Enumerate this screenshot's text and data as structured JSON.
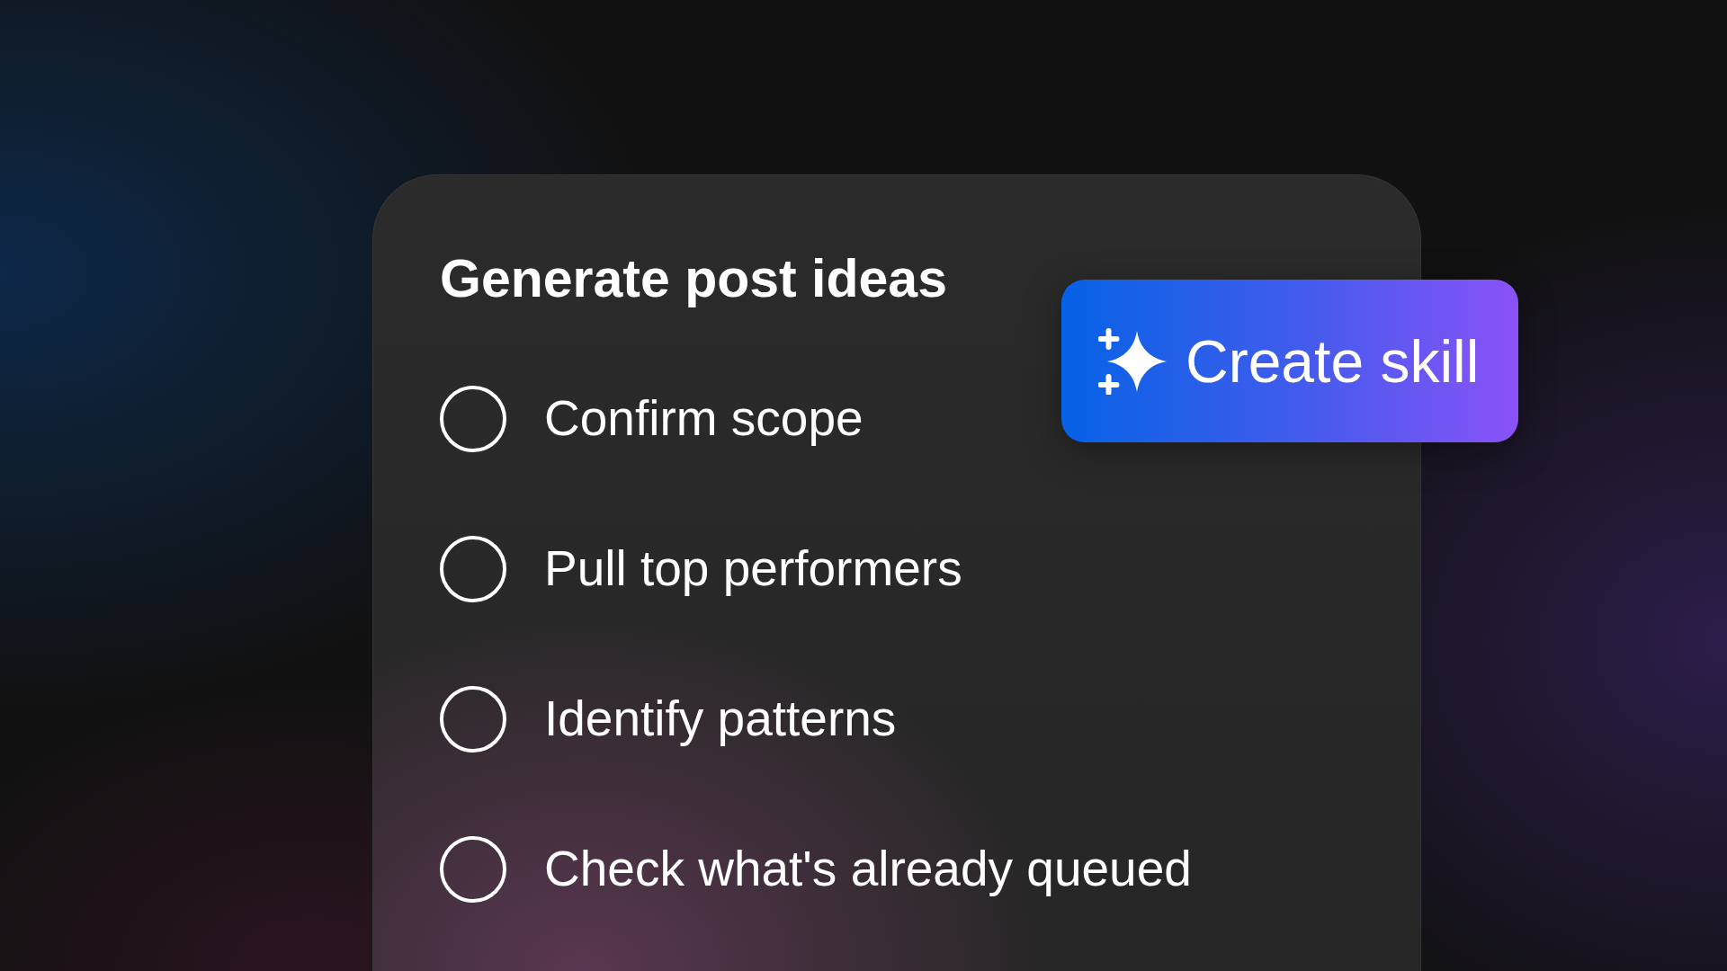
{
  "checklist": {
    "title": "Generate post ideas",
    "items": [
      {
        "label": "Confirm scope",
        "checked": false
      },
      {
        "label": "Pull top performers",
        "checked": false
      },
      {
        "label": "Identify patterns",
        "checked": false
      },
      {
        "label": "Check what's already queued",
        "checked": false
      }
    ]
  },
  "action_button": {
    "label": "Create skill"
  }
}
